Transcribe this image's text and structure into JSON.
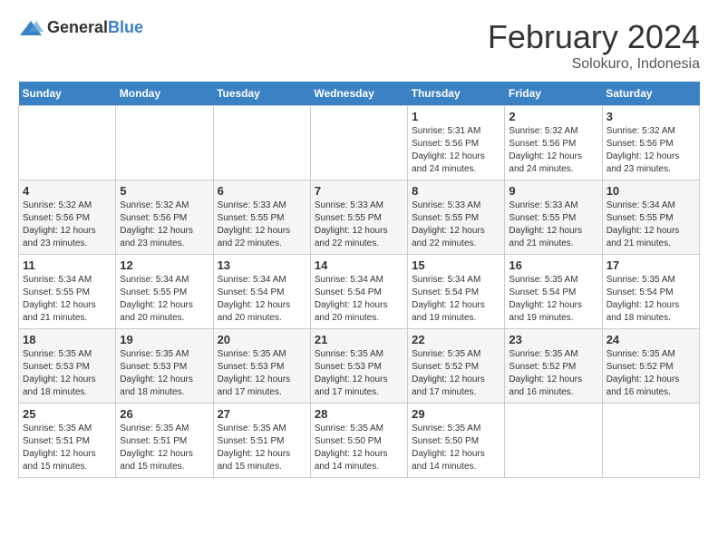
{
  "logo": {
    "text_general": "General",
    "text_blue": "Blue"
  },
  "title": {
    "month_year": "February 2024",
    "location": "Solokuro, Indonesia"
  },
  "weekdays": [
    "Sunday",
    "Monday",
    "Tuesday",
    "Wednesday",
    "Thursday",
    "Friday",
    "Saturday"
  ],
  "weeks": [
    [
      {
        "day": "",
        "detail": ""
      },
      {
        "day": "",
        "detail": ""
      },
      {
        "day": "",
        "detail": ""
      },
      {
        "day": "",
        "detail": ""
      },
      {
        "day": "1",
        "detail": "Sunrise: 5:31 AM\nSunset: 5:56 PM\nDaylight: 12 hours\nand 24 minutes."
      },
      {
        "day": "2",
        "detail": "Sunrise: 5:32 AM\nSunset: 5:56 PM\nDaylight: 12 hours\nand 24 minutes."
      },
      {
        "day": "3",
        "detail": "Sunrise: 5:32 AM\nSunset: 5:56 PM\nDaylight: 12 hours\nand 23 minutes."
      }
    ],
    [
      {
        "day": "4",
        "detail": "Sunrise: 5:32 AM\nSunset: 5:56 PM\nDaylight: 12 hours\nand 23 minutes."
      },
      {
        "day": "5",
        "detail": "Sunrise: 5:32 AM\nSunset: 5:56 PM\nDaylight: 12 hours\nand 23 minutes."
      },
      {
        "day": "6",
        "detail": "Sunrise: 5:33 AM\nSunset: 5:55 PM\nDaylight: 12 hours\nand 22 minutes."
      },
      {
        "day": "7",
        "detail": "Sunrise: 5:33 AM\nSunset: 5:55 PM\nDaylight: 12 hours\nand 22 minutes."
      },
      {
        "day": "8",
        "detail": "Sunrise: 5:33 AM\nSunset: 5:55 PM\nDaylight: 12 hours\nand 22 minutes."
      },
      {
        "day": "9",
        "detail": "Sunrise: 5:33 AM\nSunset: 5:55 PM\nDaylight: 12 hours\nand 21 minutes."
      },
      {
        "day": "10",
        "detail": "Sunrise: 5:34 AM\nSunset: 5:55 PM\nDaylight: 12 hours\nand 21 minutes."
      }
    ],
    [
      {
        "day": "11",
        "detail": "Sunrise: 5:34 AM\nSunset: 5:55 PM\nDaylight: 12 hours\nand 21 minutes."
      },
      {
        "day": "12",
        "detail": "Sunrise: 5:34 AM\nSunset: 5:55 PM\nDaylight: 12 hours\nand 20 minutes."
      },
      {
        "day": "13",
        "detail": "Sunrise: 5:34 AM\nSunset: 5:54 PM\nDaylight: 12 hours\nand 20 minutes."
      },
      {
        "day": "14",
        "detail": "Sunrise: 5:34 AM\nSunset: 5:54 PM\nDaylight: 12 hours\nand 20 minutes."
      },
      {
        "day": "15",
        "detail": "Sunrise: 5:34 AM\nSunset: 5:54 PM\nDaylight: 12 hours\nand 19 minutes."
      },
      {
        "day": "16",
        "detail": "Sunrise: 5:35 AM\nSunset: 5:54 PM\nDaylight: 12 hours\nand 19 minutes."
      },
      {
        "day": "17",
        "detail": "Sunrise: 5:35 AM\nSunset: 5:54 PM\nDaylight: 12 hours\nand 18 minutes."
      }
    ],
    [
      {
        "day": "18",
        "detail": "Sunrise: 5:35 AM\nSunset: 5:53 PM\nDaylight: 12 hours\nand 18 minutes."
      },
      {
        "day": "19",
        "detail": "Sunrise: 5:35 AM\nSunset: 5:53 PM\nDaylight: 12 hours\nand 18 minutes."
      },
      {
        "day": "20",
        "detail": "Sunrise: 5:35 AM\nSunset: 5:53 PM\nDaylight: 12 hours\nand 17 minutes."
      },
      {
        "day": "21",
        "detail": "Sunrise: 5:35 AM\nSunset: 5:53 PM\nDaylight: 12 hours\nand 17 minutes."
      },
      {
        "day": "22",
        "detail": "Sunrise: 5:35 AM\nSunset: 5:52 PM\nDaylight: 12 hours\nand 17 minutes."
      },
      {
        "day": "23",
        "detail": "Sunrise: 5:35 AM\nSunset: 5:52 PM\nDaylight: 12 hours\nand 16 minutes."
      },
      {
        "day": "24",
        "detail": "Sunrise: 5:35 AM\nSunset: 5:52 PM\nDaylight: 12 hours\nand 16 minutes."
      }
    ],
    [
      {
        "day": "25",
        "detail": "Sunrise: 5:35 AM\nSunset: 5:51 PM\nDaylight: 12 hours\nand 15 minutes."
      },
      {
        "day": "26",
        "detail": "Sunrise: 5:35 AM\nSunset: 5:51 PM\nDaylight: 12 hours\nand 15 minutes."
      },
      {
        "day": "27",
        "detail": "Sunrise: 5:35 AM\nSunset: 5:51 PM\nDaylight: 12 hours\nand 15 minutes."
      },
      {
        "day": "28",
        "detail": "Sunrise: 5:35 AM\nSunset: 5:50 PM\nDaylight: 12 hours\nand 14 minutes."
      },
      {
        "day": "29",
        "detail": "Sunrise: 5:35 AM\nSunset: 5:50 PM\nDaylight: 12 hours\nand 14 minutes."
      },
      {
        "day": "",
        "detail": ""
      },
      {
        "day": "",
        "detail": ""
      }
    ]
  ]
}
